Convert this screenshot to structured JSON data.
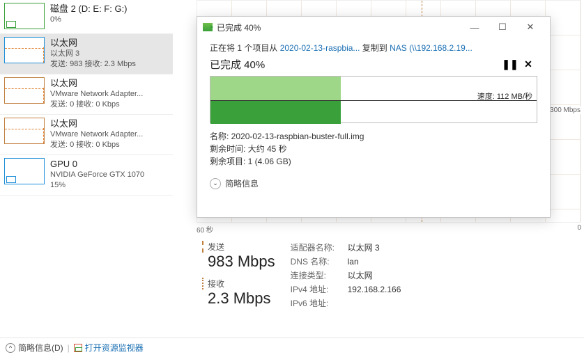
{
  "sidebar": {
    "items": [
      {
        "title": "磁盘 2 (D: E: F: G:)",
        "sub1": "0%",
        "sub2": ""
      },
      {
        "title": "以太网",
        "sub1": "以太网 3",
        "sub2": "发送: 983 接收: 2.3 Mbps"
      },
      {
        "title": "以太网",
        "sub1": "VMware Network Adapter...",
        "sub2": "发送: 0 接收: 0 Kbps"
      },
      {
        "title": "以太网",
        "sub1": "VMware Network Adapter...",
        "sub2": "发送: 0 接收: 0 Kbps"
      },
      {
        "title": "GPU 0",
        "sub1": "NVIDIA GeForce GTX 1070",
        "sub2": "15%"
      }
    ]
  },
  "graph": {
    "ylabel": "300 Mbps",
    "xleft": "60 秒",
    "xright": "0"
  },
  "stats": {
    "send_label": "发送",
    "send_value": "983 Mbps",
    "recv_label": "接收",
    "recv_value": "2.3 Mbps",
    "details": [
      {
        "k": "适配器名称:",
        "v": "以太网 3"
      },
      {
        "k": "DNS 名称:",
        "v": "lan"
      },
      {
        "k": "连接类型:",
        "v": "以太网"
      },
      {
        "k": "IPv4 地址:",
        "v": "192.168.2.166"
      },
      {
        "k": "IPv6 地址:",
        "v": ""
      }
    ]
  },
  "dialog": {
    "title": "已完成 40%",
    "line_prefix": "正在将 1 个项目从 ",
    "line_src": "2020-02-13-raspbia...",
    "line_mid": " 复制到 ",
    "line_dst": "NAS (\\\\192.168.2.19...",
    "header": "已完成 40%",
    "pause": "❚❚",
    "close": "✕",
    "speed": "速度: 112 MB/秒",
    "meta1": "名称: 2020-02-13-raspbian-buster-full.img",
    "meta2": "剩余时间: 大约 45 秒",
    "meta3": "剩余项目: 1 (4.06 GB)",
    "more": "简略信息"
  },
  "footer": {
    "brief": "简略信息(D)",
    "monitor": "打开资源监视器"
  }
}
